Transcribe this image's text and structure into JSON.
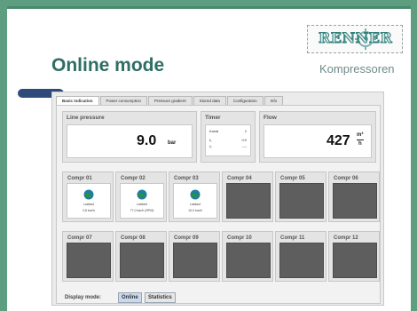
{
  "page": {
    "title": "Online mode",
    "brand_name": "RENNER",
    "brand_sub": "Kompressoren"
  },
  "tabs": [
    {
      "label": "Basic indication",
      "active": true
    },
    {
      "label": "Power consumption",
      "active": false
    },
    {
      "label": "Pressure gradient",
      "active": false
    },
    {
      "label": "Stored data",
      "active": false
    },
    {
      "label": "Configuration",
      "active": false
    },
    {
      "label": "Info",
      "active": false
    }
  ],
  "line_pressure": {
    "label": "Line pressure",
    "value": "9.0",
    "unit": "bar"
  },
  "timer": {
    "label": "Timer",
    "rows": [
      {
        "name": "Kanal",
        "value": "2"
      },
      {
        "name": "t₁",
        "value": "0:0"
      },
      {
        "name": "t₂",
        "value": "–:–"
      }
    ]
  },
  "flow": {
    "label": "Flow",
    "value": "427",
    "unit_top": "m³",
    "unit_bottom": "h"
  },
  "compressors": [
    {
      "name": "Compr 01",
      "active": true,
      "status": "Lastlauf",
      "detail": "2,8 bar/h"
    },
    {
      "name": "Compr 02",
      "active": true,
      "status": "Lastlauf",
      "detail": "77,0 bar/h (RPM)"
    },
    {
      "name": "Compr 03",
      "active": true,
      "status": "Lastlauf",
      "detail": "19,0 bar/h"
    },
    {
      "name": "Compr 04",
      "active": false,
      "status": "",
      "detail": ""
    },
    {
      "name": "Compr 05",
      "active": false,
      "status": "",
      "detail": ""
    },
    {
      "name": "Compr 06",
      "active": false,
      "status": "",
      "detail": ""
    },
    {
      "name": "Compr 07",
      "active": false,
      "status": "",
      "detail": ""
    },
    {
      "name": "Compr 08",
      "active": false,
      "status": "",
      "detail": ""
    },
    {
      "name": "Compr 09",
      "active": false,
      "status": "",
      "detail": ""
    },
    {
      "name": "Compr 10",
      "active": false,
      "status": "",
      "detail": ""
    },
    {
      "name": "Compr 11",
      "active": false,
      "status": "",
      "detail": ""
    },
    {
      "name": "Compr 12",
      "active": false,
      "status": "",
      "detail": ""
    }
  ],
  "display_mode": {
    "label": "Display mode:",
    "options": [
      {
        "label": "Online",
        "active": true
      },
      {
        "label": "Statistics",
        "active": false
      }
    ]
  },
  "colors": {
    "background": "#5d9e80",
    "title": "#2e6e64",
    "accent_pill": "#2e4a7a",
    "offline_cell": "#5e5e5e"
  },
  "icons": {
    "compressor_status": "globe-icon",
    "logo_emblem": "gear-icon"
  }
}
